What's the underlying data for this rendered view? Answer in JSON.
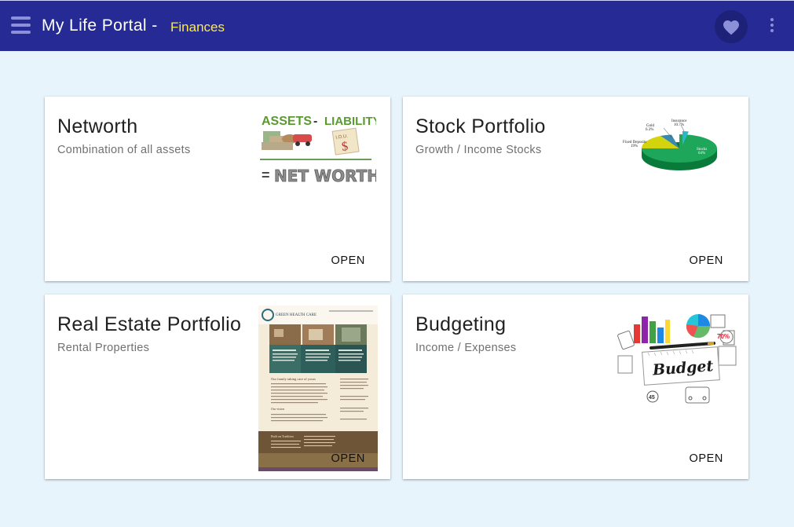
{
  "appbar": {
    "title": "My Life Portal -",
    "section": "Finances",
    "background": "#262a94",
    "section_color": "#ffeb3b",
    "icons": {
      "menu": "menu-icon",
      "favorite": "heart-icon",
      "more": "more-vert-icon"
    }
  },
  "page": {
    "background": "#e8f4fc"
  },
  "cards": [
    {
      "title": "Networth",
      "subtitle": "Combination of all assets",
      "action": "OPEN",
      "image": {
        "word_assets": "ASSETS",
        "minus": "-",
        "word_liability": "LIABILITY",
        "iou": "I.O.U.",
        "dollar": "$",
        "equals": "=",
        "word_networth": "NET WORTH"
      }
    },
    {
      "title": "Stock Portfolio",
      "subtitle": "Growth / Income Stocks",
      "action": "OPEN",
      "image": {
        "label_insurance": "Insurance",
        "label_insurance_pct": "10.7%",
        "label_gold": "Gold",
        "label_gold_pct": "6.3%",
        "label_fd": "Fixed Deposits",
        "label_fd_pct": "19%",
        "label_stocks": "Stocks",
        "label_stocks_pct": "64%"
      }
    },
    {
      "title": "Real Estate Portfolio",
      "subtitle": "Rental Properties",
      "action": "OPEN",
      "image": {
        "brand": "GREEN HEALTH CARE",
        "heading": "Our family taking care of yours",
        "section": "Our vision",
        "section2": "Built on Tradition"
      }
    },
    {
      "title": "Budgeting",
      "subtitle": "Income / Expenses",
      "action": "OPEN",
      "image": {
        "word": "Budget",
        "pct": "70%",
        "num": "45"
      }
    }
  ]
}
